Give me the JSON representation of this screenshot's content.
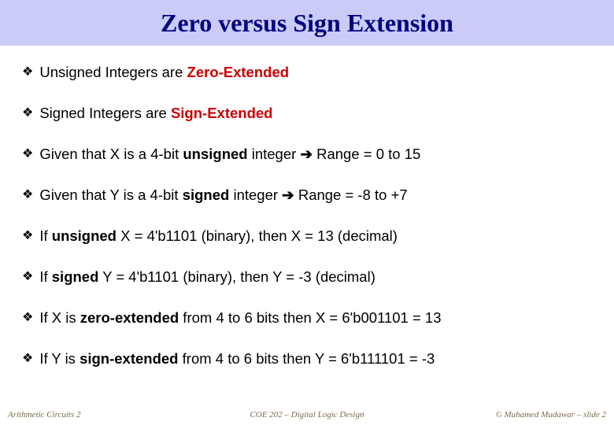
{
  "title": "Zero versus Sign Extension",
  "bullets": [
    {
      "pre": "Unsigned Integers are ",
      "hl": "Zero-Extended",
      "post": ""
    },
    {
      "pre": "Signed Integers are ",
      "hl": "Sign-Extended",
      "post": ""
    },
    {
      "pre": "Given that X is a 4-bit ",
      "b1": "unsigned",
      "mid1": " integer ",
      "arrow": "➔",
      "post": " Range = 0 to 15"
    },
    {
      "pre": "Given that Y is a 4-bit ",
      "b1": "signed",
      "mid1": " integer ",
      "arrow": "➔",
      "post": " Range = -8 to +7"
    },
    {
      "pre": "If ",
      "b1": "unsigned",
      "post": " X = 4'b1101 (binary), then X = 13 (decimal)"
    },
    {
      "pre": "If ",
      "b1": "signed",
      "post": " Y = 4'b1101 (binary), then Y = -3 (decimal)"
    },
    {
      "pre": "If X is ",
      "b1": "zero-extended",
      "post": " from 4 to 6 bits then X = 6'b001101 = 13"
    },
    {
      "pre": "If Y is ",
      "b1": "sign-extended",
      "post": " from 4 to 6 bits then Y = 6'b111101 = -3"
    }
  ],
  "footer": {
    "left": "Arithmetic Circuits 2",
    "center": "COE 202 – Digital Logic Design",
    "right": "© Muhamed Mudawar – slide 2"
  },
  "glyph": "❖"
}
